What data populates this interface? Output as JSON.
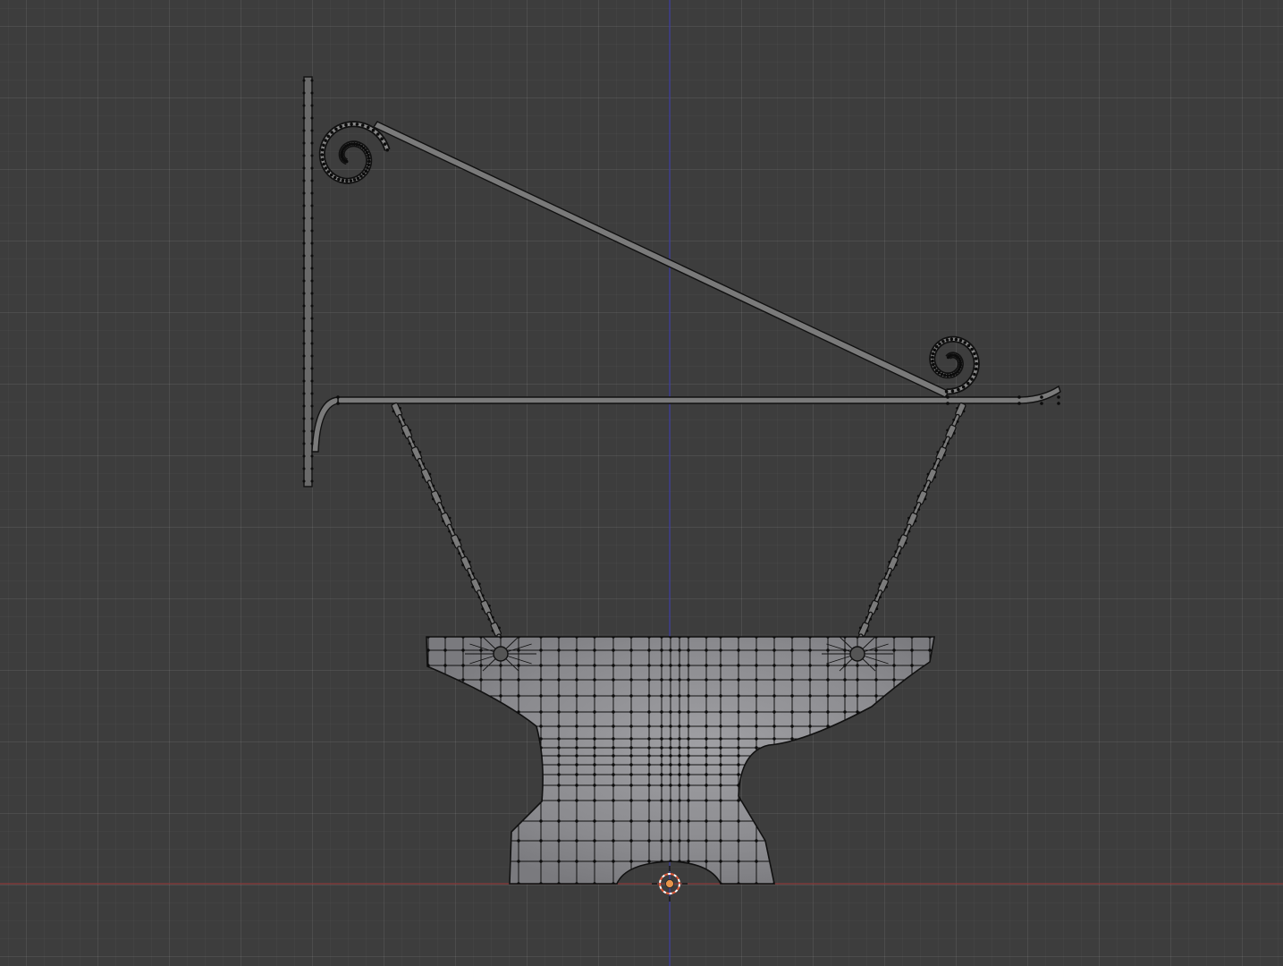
{
  "viewport": {
    "background_color": "#3d3d3d",
    "axis_x_color": "#8a3a3a",
    "axis_z_color": "#3a3a9a",
    "wire_color": "#111111",
    "mesh_face_color": "#8c8c90",
    "metal_color": "#9a9a9a",
    "cursor_colors": [
      "#e05a3a",
      "#ffffff"
    ]
  },
  "objects": [
    {
      "name": "wall-bracket",
      "kind": "mesh"
    },
    {
      "name": "chain-left",
      "kind": "mesh"
    },
    {
      "name": "chain-right",
      "kind": "mesh"
    },
    {
      "name": "anvil-sign",
      "kind": "mesh"
    }
  ],
  "icons": {
    "cursor": "3d-cursor-icon",
    "spiral": "scroll-spiral-icon"
  }
}
